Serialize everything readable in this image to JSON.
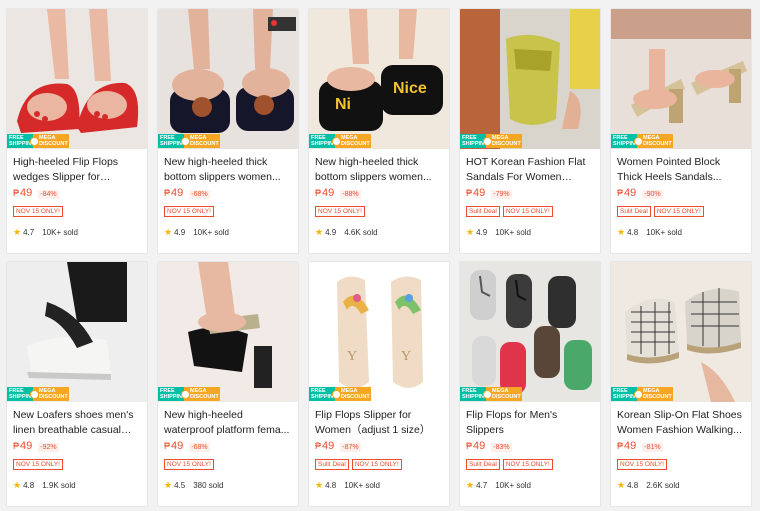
{
  "colors": {
    "accent": "#ee4d2d",
    "free_shipping": "#00bfa5",
    "mega_discount": "#f5a623",
    "star": "#f7b500"
  },
  "badges": {
    "free_shipping": "FREE SHIPPING",
    "mega_discount": "MEGA DISCOUNT"
  },
  "currency": "₱",
  "products": [
    {
      "title": "High-heeled Flip Flops wedges Slipper for Wome...",
      "price": "49",
      "discount": "-84%",
      "tags": [
        "NOV 15 ONLY!"
      ],
      "rating": "4.7",
      "sold": "10K+ sold"
    },
    {
      "title": "New high-heeled thick bottom slippers women...",
      "price": "49",
      "discount": "-68%",
      "tags": [
        "NOV 15 ONLY!"
      ],
      "rating": "4.9",
      "sold": "10K+ sold"
    },
    {
      "title": "New high-heeled thick bottom slippers women...",
      "price": "49",
      "discount": "-88%",
      "tags": [
        "NOV 15 ONLY!"
      ],
      "rating": "4.9",
      "sold": "4.6K sold"
    },
    {
      "title": "HOT Korean Fashion Flat Sandals For Women High...",
      "price": "49",
      "discount": "-79%",
      "tags": [
        "Sulit Deal",
        "NOV 15 ONLY!"
      ],
      "rating": "4.9",
      "sold": "10K+ sold"
    },
    {
      "title": "Women Pointed Block Thick Heels Sandals...",
      "price": "49",
      "discount": "-90%",
      "tags": [
        "Sulit Deal",
        "NOV 15 ONLY!"
      ],
      "rating": "4.8",
      "sold": "10K+ sold"
    },
    {
      "title": "New Loafers shoes men's linen breathable casual so...",
      "price": "49",
      "discount": "-92%",
      "tags": [
        "NOV 15 ONLY!"
      ],
      "rating": "4.8",
      "sold": "1.9K sold"
    },
    {
      "title": "New high-heeled waterproof platform fema...",
      "price": "49",
      "discount": "-68%",
      "tags": [
        "NOV 15 ONLY!"
      ],
      "rating": "4.5",
      "sold": "380 sold"
    },
    {
      "title": "Flip Flops Slipper for Women（adjust 1 size）",
      "price": "49",
      "discount": "-87%",
      "tags": [
        "Sulit Deal",
        "NOV 15 ONLY!"
      ],
      "rating": "4.8",
      "sold": "10K+ sold"
    },
    {
      "title": "Flip Flops for Men's Slippers",
      "price": "49",
      "discount": "-83%",
      "tags": [
        "Sulit Deal",
        "NOV 15 ONLY!"
      ],
      "rating": "4.7",
      "sold": "10K+ sold"
    },
    {
      "title": "Korean Slip-On Flat Shoes Women Fashion Walking...",
      "price": "49",
      "discount": "-81%",
      "tags": [
        "NOV 15 ONLY!"
      ],
      "rating": "4.8",
      "sold": "2.6K sold"
    }
  ]
}
